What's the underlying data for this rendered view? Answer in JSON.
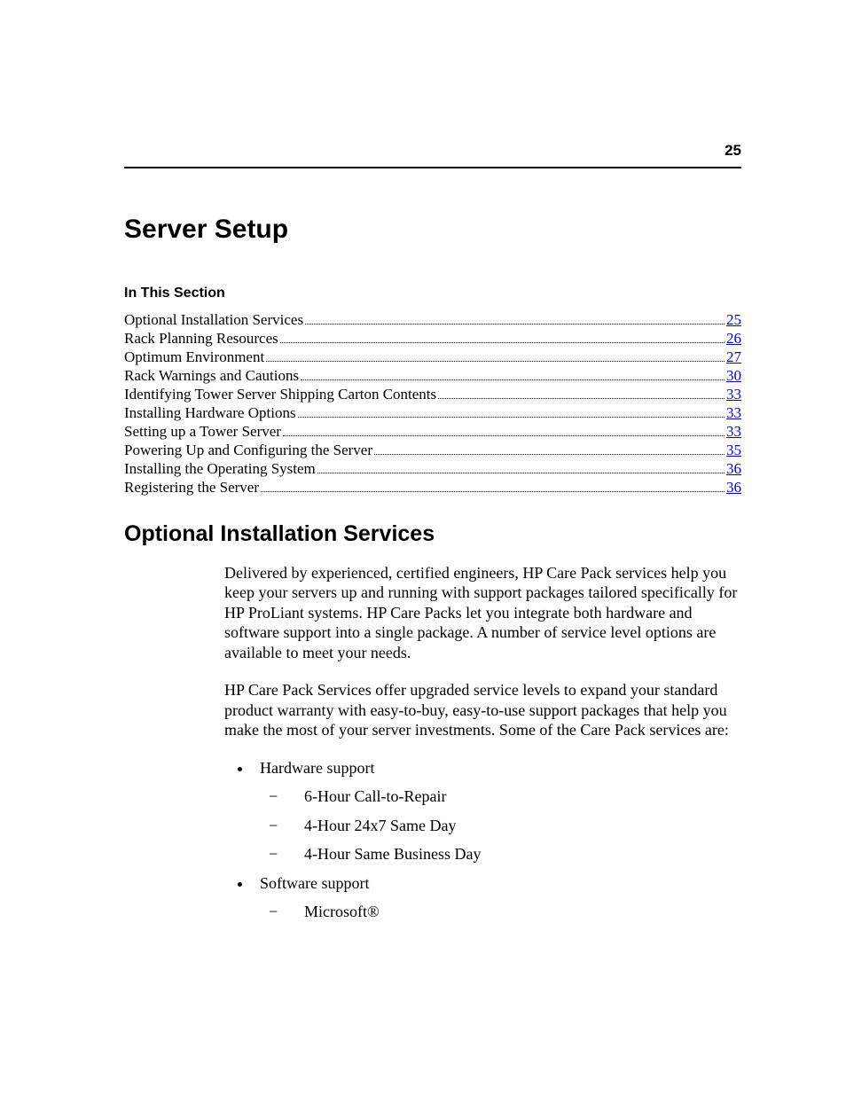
{
  "pageNumber": "25",
  "chapterTitle": "Server Setup",
  "sectionLabel": "In This Section",
  "toc": [
    {
      "label": "Optional Installation Services",
      "page": "25"
    },
    {
      "label": "Rack Planning Resources",
      "page": "26"
    },
    {
      "label": "Optimum Environment",
      "page": "27"
    },
    {
      "label": "Rack Warnings and Cautions",
      "page": "30"
    },
    {
      "label": "Identifying Tower Server Shipping Carton Contents",
      "page": "33"
    },
    {
      "label": "Installing Hardware Options",
      "page": "33"
    },
    {
      "label": "Setting up a Tower Server",
      "page": "33"
    },
    {
      "label": "Powering Up and Configuring the Server",
      "page": "35"
    },
    {
      "label": "Installing the Operating System",
      "page": "36"
    },
    {
      "label": "Registering the Server",
      "page": "36"
    }
  ],
  "heading2": "Optional Installation Services",
  "para1": "Delivered by experienced, certified engineers, HP Care Pack services help you keep your servers up and running with support packages tailored specifically for HP ProLiant systems. HP Care Packs let you integrate both hardware and software support into a single package. A number of service level options are available to meet your needs.",
  "para2": "HP Care Pack Services offer upgraded service levels to expand your standard product warranty with easy-to-buy, easy-to-use support packages that help you make the most of your server investments. Some of the Care Pack services are:",
  "list": [
    {
      "label": "Hardware support",
      "sub": [
        "6-Hour Call-to-Repair",
        "4-Hour 24x7 Same Day",
        "4-Hour Same Business Day"
      ]
    },
    {
      "label": "Software support",
      "sub": [
        "Microsoft®"
      ]
    }
  ]
}
